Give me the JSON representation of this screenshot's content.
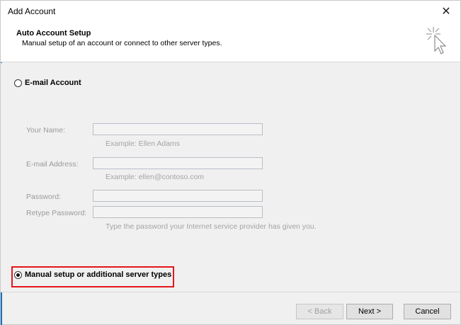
{
  "window": {
    "title": "Add Account",
    "close_glyph": "✕"
  },
  "header": {
    "title": "Auto Account Setup",
    "subtitle": "Manual setup of an account or connect to other server types.",
    "icon": "wizard-cursor-icon"
  },
  "options": {
    "email_account": {
      "label": "E-mail Account",
      "selected": false
    },
    "manual_setup": {
      "label": "Manual setup or additional server types",
      "selected": true
    }
  },
  "form": {
    "your_name": {
      "label": "Your Name:",
      "value": "",
      "hint": "Example: Ellen Adams"
    },
    "email_address": {
      "label": "E-mail Address:",
      "value": "",
      "hint": "Example: ellen@contoso.com"
    },
    "password": {
      "label": "Password:",
      "value": ""
    },
    "retype_password": {
      "label": "Retype Password:",
      "value": "",
      "hint": "Type the password your Internet service provider has given you."
    }
  },
  "buttons": {
    "back": "< Back",
    "next": "Next >",
    "cancel": "Cancel"
  },
  "colors": {
    "highlight": "#e4161c",
    "accent": "#1e6fb8"
  }
}
